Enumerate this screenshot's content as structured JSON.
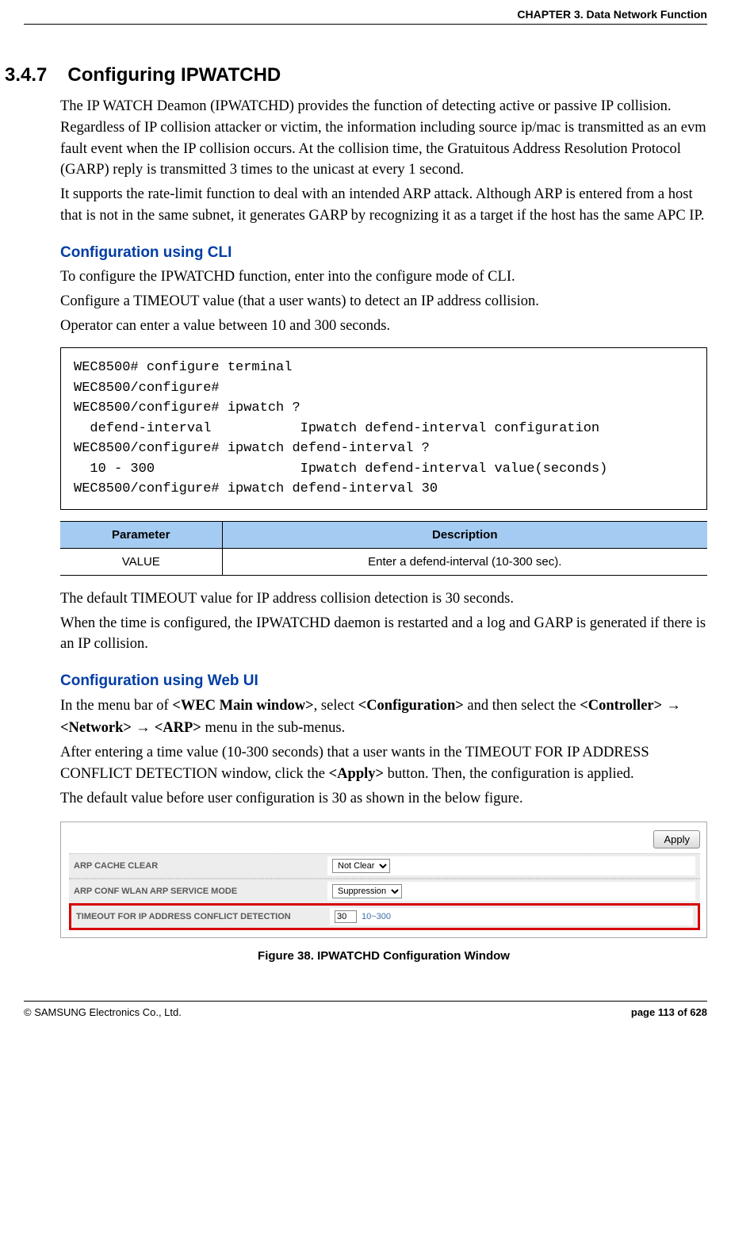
{
  "header": {
    "chapter": "CHAPTER 3. Data Network Function"
  },
  "section": {
    "number": "3.4.7",
    "title": "Configuring IPWATCHD",
    "intro_p1": "The IP WATCH Deamon (IPWATCHD) provides the function of detecting active or passive IP collision. Regardless of IP collision attacker or victim, the information including source ip/mac is transmitted as an evm fault event when the IP collision occurs. At the collision time, the Gratuitous Address Resolution Protocol (GARP) reply is transmitted 3 times to the unicast at every 1 second.",
    "intro_p2": "It supports the rate-limit function to deal with an intended ARP attack. Although ARP is entered from a host that is not in the same subnet, it generates GARP by recognizing it as a target if the host has the same APC IP."
  },
  "cli": {
    "heading": "Configuration using CLI",
    "p1": "To configure the IPWATCHD function, enter into the configure mode of CLI.",
    "p2": "Configure a TIMEOUT value (that a user wants) to detect an IP address collision.",
    "p3": "Operator can enter a value between 10 and 300 seconds.",
    "code": "WEC8500# configure terminal\nWEC8500/configure#\nWEC8500/configure# ipwatch ?\n  defend-interval           Ipwatch defend-interval configuration\nWEC8500/configure# ipwatch defend-interval ?\n  10 - 300                  Ipwatch defend-interval value(seconds)\nWEC8500/configure# ipwatch defend-interval 30"
  },
  "table": {
    "headers": [
      "Parameter",
      "Description"
    ],
    "rows": [
      {
        "param": "VALUE",
        "desc": "Enter a defend-interval (10-300 sec)."
      }
    ]
  },
  "post_cli": {
    "p1": "The default TIMEOUT value for IP address collision detection is 30 seconds.",
    "p2": "When the time is configured, the IPWATCHD daemon is restarted and a log and GARP is generated if there is an IP collision."
  },
  "webui": {
    "heading": "Configuration using Web UI",
    "nav_prefix": "In the menu bar of ",
    "nav_main": "<WEC Main window>",
    "nav_mid1": ", select ",
    "nav_config": "<Configuration>",
    "nav_mid2": " and then select the ",
    "nav_controller": "<Controller>",
    "nav_network": "<Network>",
    "nav_arp": "<ARP>",
    "nav_tail": " menu in the sub-menus.",
    "p2a": "After entering a time value (10-300 seconds) that a user wants in the TIMEOUT FOR IP ADDRESS CONFLICT DETECTION window, click the ",
    "apply_b": "<Apply>",
    "p2b": " button. Then, the configuration is applied.",
    "p3": "The default value before user configuration is 30 as shown in the below figure."
  },
  "figure": {
    "apply_label": "Apply",
    "rows": [
      {
        "label": "ARP CACHE CLEAR",
        "type": "select",
        "value": "Not Clear"
      },
      {
        "label": "ARP CONF WLAN ARP SERVICE MODE",
        "type": "select",
        "value": "Suppression"
      },
      {
        "label": "TIMEOUT FOR IP ADDRESS CONFLICT DETECTION",
        "type": "input",
        "value": "30",
        "hint": "10~300",
        "highlight": true
      }
    ],
    "caption": "Figure 38. IPWATCHD Configuration Window"
  },
  "footer": {
    "copyright": "© SAMSUNG Electronics Co., Ltd.",
    "page": "page 113 of 628"
  },
  "arrow": " → "
}
